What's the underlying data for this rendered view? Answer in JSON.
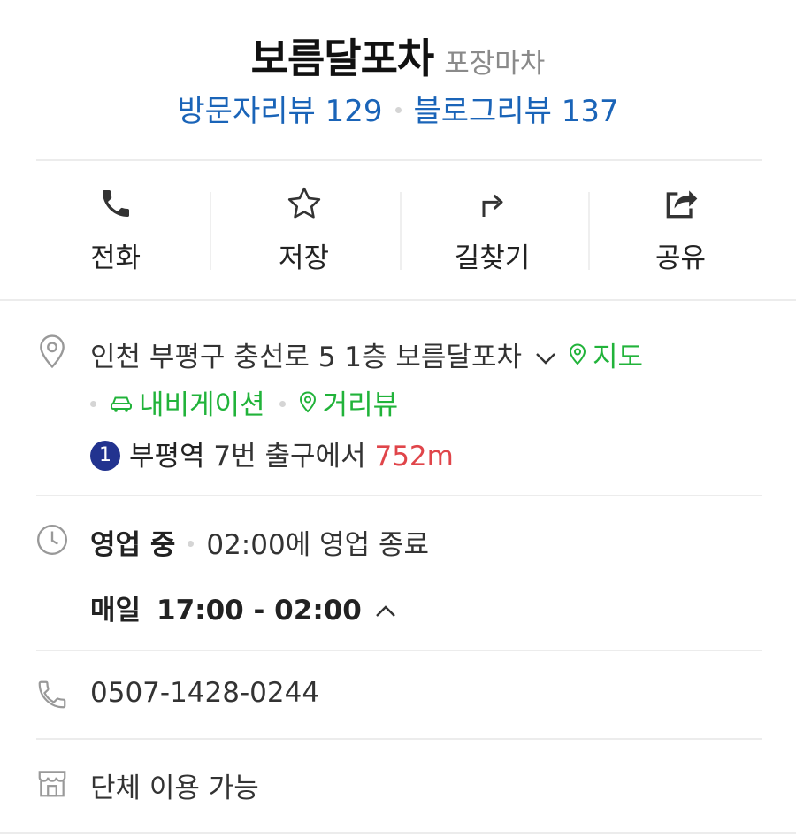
{
  "header": {
    "place_name": "보름달포차",
    "category": "포장마차",
    "visitor_reviews": "방문자리뷰 129",
    "blog_reviews": "블로그리뷰 137"
  },
  "actions": [
    {
      "label": "전화",
      "icon": "phone-icon"
    },
    {
      "label": "저장",
      "icon": "star-icon"
    },
    {
      "label": "길찾기",
      "icon": "directions-icon"
    },
    {
      "label": "공유",
      "icon": "share-icon"
    }
  ],
  "address": {
    "text": "인천 부평구 충선로 5 1층 보름달포차",
    "map_link": "지도",
    "navigation_link": "내비게이션",
    "street_view_link": "거리뷰",
    "subway_line": "1",
    "subway_station": "부평역",
    "subway_exit": "7번 출구에서",
    "distance": "752m"
  },
  "hours": {
    "status": "영업 중",
    "closing_note": "02:00에 영업 종료",
    "days": "매일",
    "time_range": "17:00 - 02:00"
  },
  "phone": {
    "number": "0507-1428-0244"
  },
  "facility": {
    "text": "단체 이용 가능"
  },
  "colors": {
    "link_blue": "#1a64b8",
    "green": "#21b33a",
    "distance_red": "#e0454a",
    "subway_line_1": "#22338f"
  }
}
